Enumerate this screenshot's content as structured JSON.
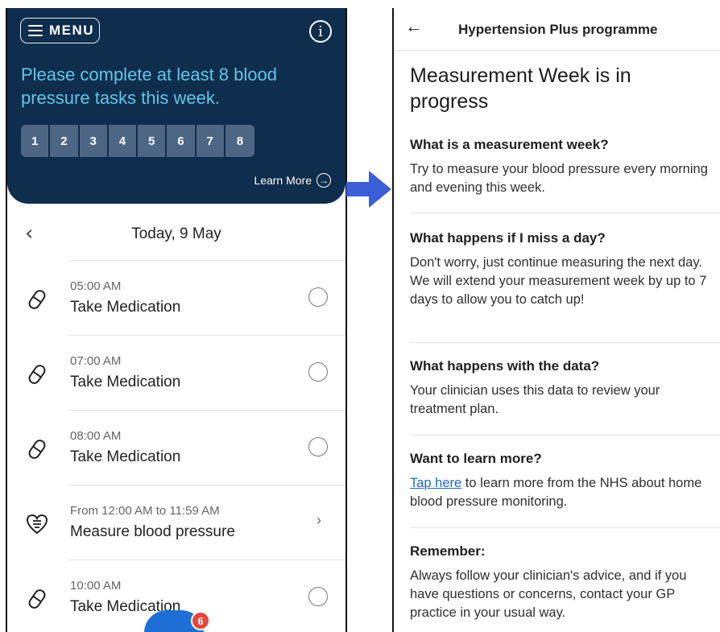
{
  "left": {
    "menu_label": "MENU",
    "prompt": "Please complete at least 8 blood pressure tasks this week.",
    "task_numbers": [
      "1",
      "2",
      "3",
      "4",
      "5",
      "6",
      "7",
      "8"
    ],
    "learn_more": "Learn More",
    "date_title": "Today, 9 May",
    "tasks": [
      {
        "time": "05:00 AM",
        "name": "Take Medication",
        "icon": "pill-icon"
      },
      {
        "time": "07:00 AM",
        "name": "Take Medication",
        "icon": "pill-icon"
      },
      {
        "time": "08:00 AM",
        "name": "Take Medication",
        "icon": "pill-icon"
      },
      {
        "time": "From 12:00 AM to 11:59 AM",
        "name": "Measure blood pressure",
        "icon": "heart-monitor-icon"
      },
      {
        "time": "10:00 AM",
        "name": "Take Medication",
        "icon": "pill-icon"
      }
    ],
    "badge_count": "6",
    "colors": {
      "header_bg": "#0f2d4c",
      "prompt_text": "#62c6e9",
      "fab": "#1d6fd6",
      "badge": "#e5453a"
    }
  },
  "right": {
    "title": "Hypertension Plus programme",
    "heading": "Measurement Week is in progress",
    "sections": [
      {
        "q": "What is a measurement week?",
        "a": "Try to measure your blood pressure every morning and evening this week."
      },
      {
        "q": "What happens if I miss a day?",
        "a": "Don't worry, just continue measuring the next day. We will extend your measurement week by up to 7 days to allow you to catch up!"
      },
      {
        "q": "What happens with the data?",
        "a": "Your clinician uses this data to review your treatment plan."
      },
      {
        "q": "Want to learn more?",
        "link": "Tap here",
        "a": " to learn more from the NHS about home blood pressure monitoring."
      },
      {
        "q": "Remember:",
        "a": "Always follow your clinician's advice, and if you have questions or concerns, contact your GP practice in your usual way."
      }
    ],
    "colors": {
      "link": "#1f67c3"
    }
  },
  "arrow_color": "#3b5fd6"
}
